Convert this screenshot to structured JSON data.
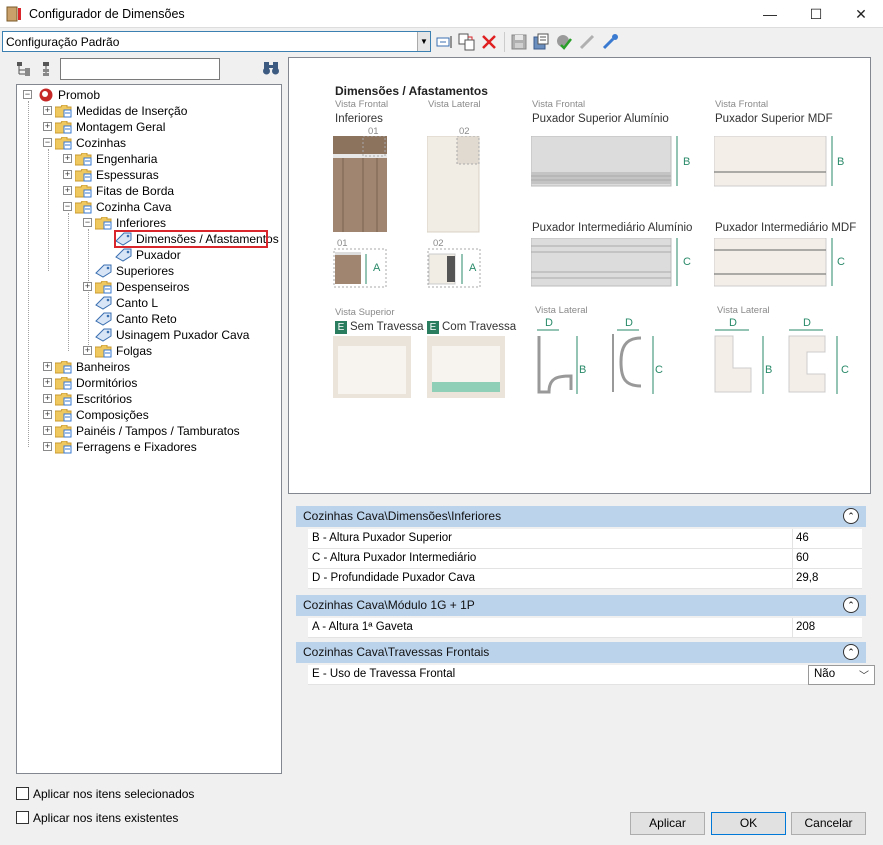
{
  "window": {
    "title": "Configurador de Dimensões",
    "minimize": "—",
    "maximize": "☐",
    "close": "✕"
  },
  "toolbar": {
    "config_value": "Configuração Padrão",
    "icons": [
      "rename-icon",
      "copy-config-icon",
      "delete-icon",
      "save-icon",
      "export-icon",
      "apply-check-icon",
      "link-icon",
      "link-edit-icon"
    ]
  },
  "tree": {
    "search_value": "",
    "items": [
      {
        "label": "Promob"
      },
      {
        "label": "Medidas de Inserção"
      },
      {
        "label": "Montagem Geral"
      },
      {
        "label": "Cozinhas"
      },
      {
        "label": "Engenharia"
      },
      {
        "label": "Espessuras"
      },
      {
        "label": "Fitas de Borda"
      },
      {
        "label": "Cozinha Cava"
      },
      {
        "label": "Inferiores"
      },
      {
        "label": "Dimensões / Afastamentos"
      },
      {
        "label": "Puxador"
      },
      {
        "label": "Superiores"
      },
      {
        "label": "Despenseiros"
      },
      {
        "label": "Canto L"
      },
      {
        "label": "Canto Reto"
      },
      {
        "label": "Usinagem Puxador Cava"
      },
      {
        "label": "Folgas"
      },
      {
        "label": "Banheiros"
      },
      {
        "label": "Dormitórios"
      },
      {
        "label": "Escritórios"
      },
      {
        "label": "Composições"
      },
      {
        "label": "Painéis / Tampos / Tamburatos"
      },
      {
        "label": "Ferragens e Fixadores"
      }
    ]
  },
  "checkboxes": {
    "selected_items": "Aplicar nos itens selecionados",
    "existing_items": "Aplicar nos itens existentes"
  },
  "diagram": {
    "title": "Dimensões / Afastamentos",
    "vista_frontal": "Vista Frontal",
    "vista_lateral": "Vista Lateral",
    "vista_superior": "Vista Superior",
    "inferiores": "Inferiores",
    "puxador_sup_aluminio": "Puxador Superior Alumínio",
    "puxador_sup_mdf": "Puxador Superior MDF",
    "puxador_int_aluminio": "Puxador Intermediário Alumínio",
    "puxador_int_mdf": "Puxador Intermediário MDF",
    "sem_travessa": "Sem Travessa",
    "com_travessa": "Com Travessa",
    "e_badge": "E",
    "label_01": "01",
    "label_02": "02",
    "A": "A",
    "B": "B",
    "C": "C",
    "D": "D"
  },
  "properties": {
    "categories": [
      {
        "label": "Cozinhas Cava\\Dimensões\\Inferiores",
        "rows": [
          {
            "name": "B - Altura Puxador Superior",
            "value": "46"
          },
          {
            "name": "C - Altura Puxador Intermediário",
            "value": "60"
          },
          {
            "name": "D - Profundidade Puxador Cava",
            "value": "29,8"
          }
        ]
      },
      {
        "label": "Cozinhas Cava\\Módulo 1G + 1P",
        "rows": [
          {
            "name": "A - Altura 1ª Gaveta",
            "value": "208"
          }
        ]
      },
      {
        "label": "Cozinhas Cava\\Travessas Frontais",
        "rows": [
          {
            "name": "E - Uso de Travessa Frontal",
            "value": "Não"
          }
        ]
      }
    ]
  },
  "buttons": {
    "apply": "Aplicar",
    "ok": "OK",
    "cancel": "Cancelar"
  }
}
